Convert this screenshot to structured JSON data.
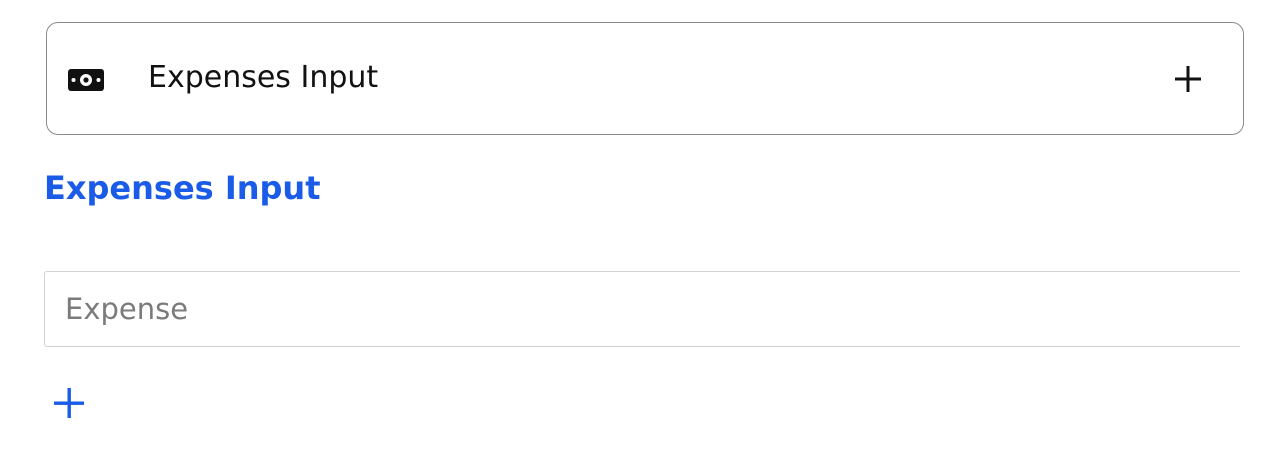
{
  "accordion": {
    "title": "Expenses Input",
    "icon": "money-bill-icon",
    "expand_icon": "plus-icon"
  },
  "section": {
    "title": "Expenses Input"
  },
  "expense_field": {
    "placeholder": "Expense",
    "value": ""
  },
  "add_button": {
    "icon": "plus-icon"
  },
  "colors": {
    "accent": "#1a5be8",
    "text": "#111111",
    "border": "#8a8a8a",
    "input_border": "#d3d3d3",
    "placeholder": "#7b7b7b"
  }
}
